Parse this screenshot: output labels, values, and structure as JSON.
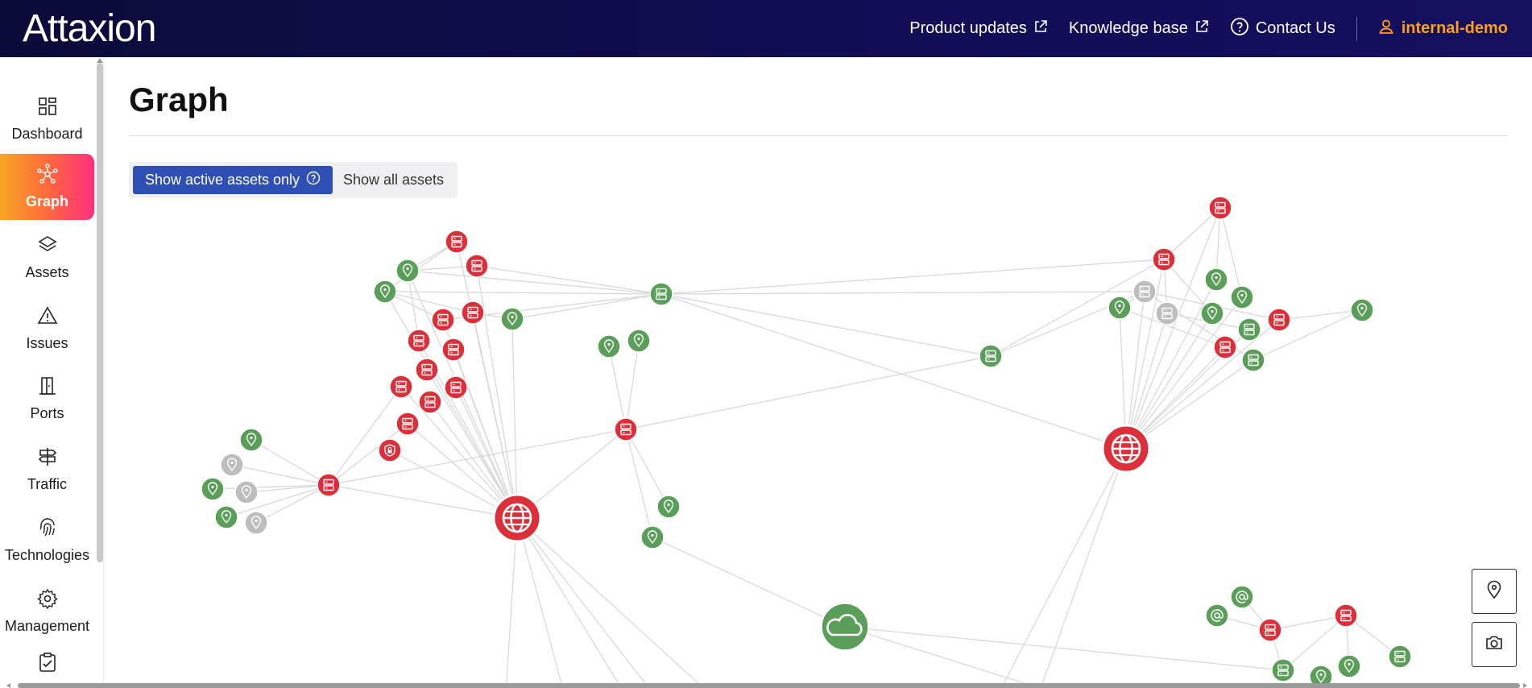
{
  "brand": {
    "logo_text": "Attaxion"
  },
  "topnav": {
    "product_updates": "Product updates",
    "knowledge_base": "Knowledge base",
    "contact_us": "Contact Us",
    "user": "internal-demo"
  },
  "sidebar": {
    "items": [
      {
        "label": "Dashboard",
        "icon": "dashboard-icon"
      },
      {
        "label": "Graph",
        "icon": "graph-icon",
        "active": true
      },
      {
        "label": "Assets",
        "icon": "layers-icon"
      },
      {
        "label": "Issues",
        "icon": "warning-icon"
      },
      {
        "label": "Ports",
        "icon": "door-icon"
      },
      {
        "label": "Traffic",
        "icon": "signpost-icon"
      },
      {
        "label": "Technologies",
        "icon": "fingerprint-icon"
      },
      {
        "label": "Management",
        "icon": "gear-icon"
      },
      {
        "label": "",
        "icon": "clipboard-check-icon"
      }
    ]
  },
  "page": {
    "title": "Graph",
    "filter_active": "Show active assets only",
    "filter_other": "Show all assets"
  },
  "colors": {
    "red": "#dc2f3a",
    "green": "#5a9e5a",
    "gray": "#bdbdbd",
    "accent_blue": "#2e4fb5",
    "user_orange": "#ff9f1a"
  },
  "graph": {
    "node_types": [
      "domain-globe",
      "server",
      "location-pin",
      "cloud",
      "email",
      "shield"
    ],
    "legend_controls": [
      "location-pin-icon",
      "camera-icon"
    ]
  }
}
